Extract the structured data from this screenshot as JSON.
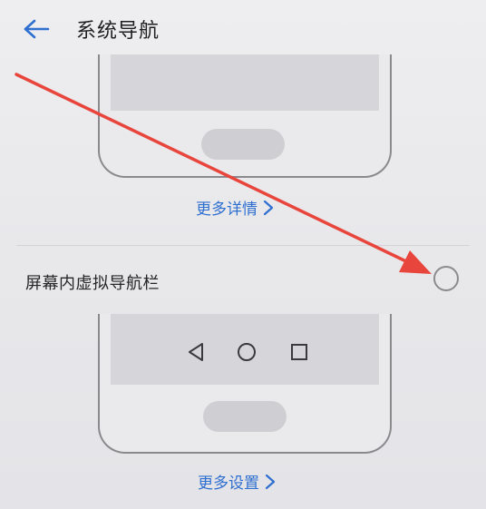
{
  "header": {
    "title": "系统导航",
    "back_icon": "arrow-left-icon"
  },
  "section_gesture": {
    "more_details_label": "更多详情",
    "chevron_icon": "chevron-right-icon"
  },
  "section_virtual_nav": {
    "option_label": "屏幕内虚拟导航栏",
    "selected": false,
    "nav_keys": [
      "back-triangle-icon",
      "home-circle-icon",
      "recents-square-icon"
    ],
    "more_settings_label": "更多设置",
    "chevron_icon": "chevron-right-icon"
  },
  "colors": {
    "link": "#2f6fcf",
    "annotation_arrow": "#e8453c",
    "outline": "#8a8a8e"
  }
}
